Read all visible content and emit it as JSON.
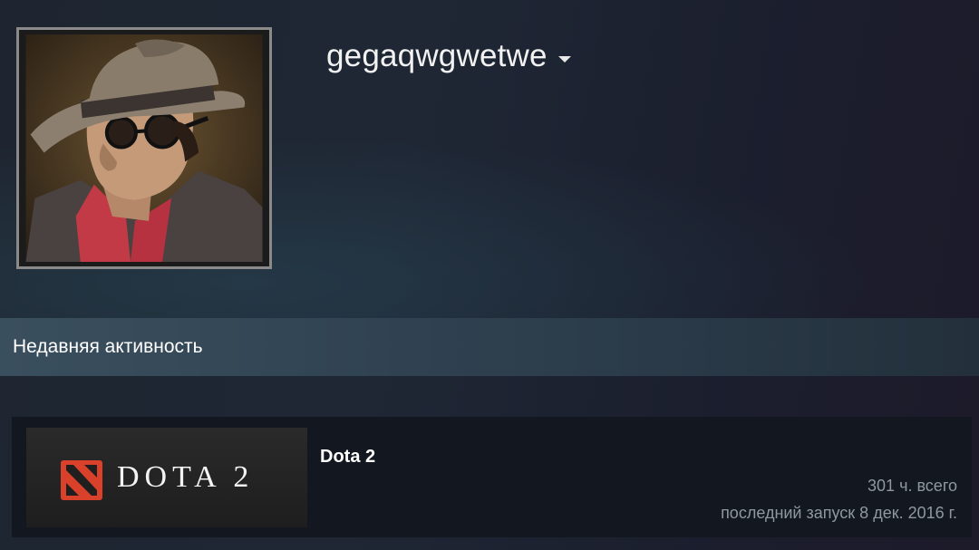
{
  "profile": {
    "username": "gegaqwgwetwe",
    "avatar": "sniper-character-avatar"
  },
  "activity": {
    "title": "Недавняя активность"
  },
  "game": {
    "name": "Dota 2",
    "banner_logo_text": "DOTA 2",
    "logo_icon": "dota-logo-icon",
    "hours": "301 ч. всего",
    "last_played": "последний запуск 8 дек. 2016 г."
  },
  "colors": {
    "activity_bar": "#3a4f5e",
    "dota_red": "#d9412a",
    "muted_text": "#8f98a0"
  }
}
